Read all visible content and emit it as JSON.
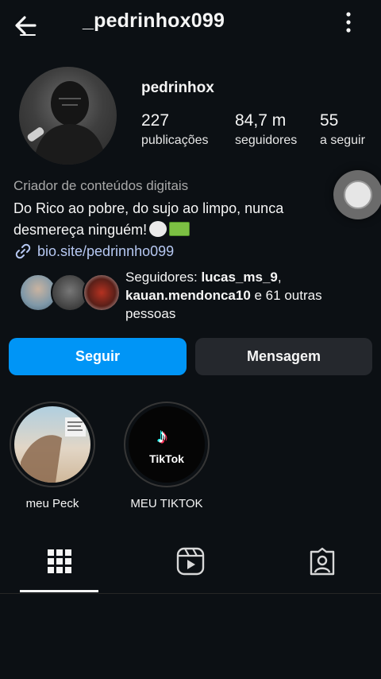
{
  "header": {
    "back_icon": "back-arrow-icon",
    "username": "_pedrinhox099",
    "more_icon": "more-vertical-icon"
  },
  "profile": {
    "display_name": "pedrinhox",
    "stats": [
      {
        "value": "227",
        "label": "publicações"
      },
      {
        "value": "84,7 m",
        "label": "seguidores"
      },
      {
        "value": "55",
        "label": "a seguir"
      }
    ],
    "category": "Criador de conteúdos digitais",
    "bio_line1": "Do Rico ao pobre, do sujo ao limpo, nunca",
    "bio_line2": "desmereça ninguém!",
    "link": "bio.site/pedrinnho099"
  },
  "followers": {
    "prefix": "Seguidores: ",
    "user1": "lucas_ms_9",
    "sep": ",",
    "user2": "kauan.mendonca10",
    "suffix": " e 61 outras pessoas"
  },
  "actions": {
    "follow_label": "Seguir",
    "message_label": "Mensagem",
    "follow_color": "#0095f6"
  },
  "highlights": [
    {
      "label": "meu Peck"
    },
    {
      "label": "MEU TIKTOK",
      "cover_text": "TikTok"
    }
  ],
  "tabs": [
    {
      "icon": "grid-icon",
      "active": true
    },
    {
      "icon": "reels-icon",
      "active": false
    },
    {
      "icon": "tagged-icon",
      "active": false
    }
  ]
}
